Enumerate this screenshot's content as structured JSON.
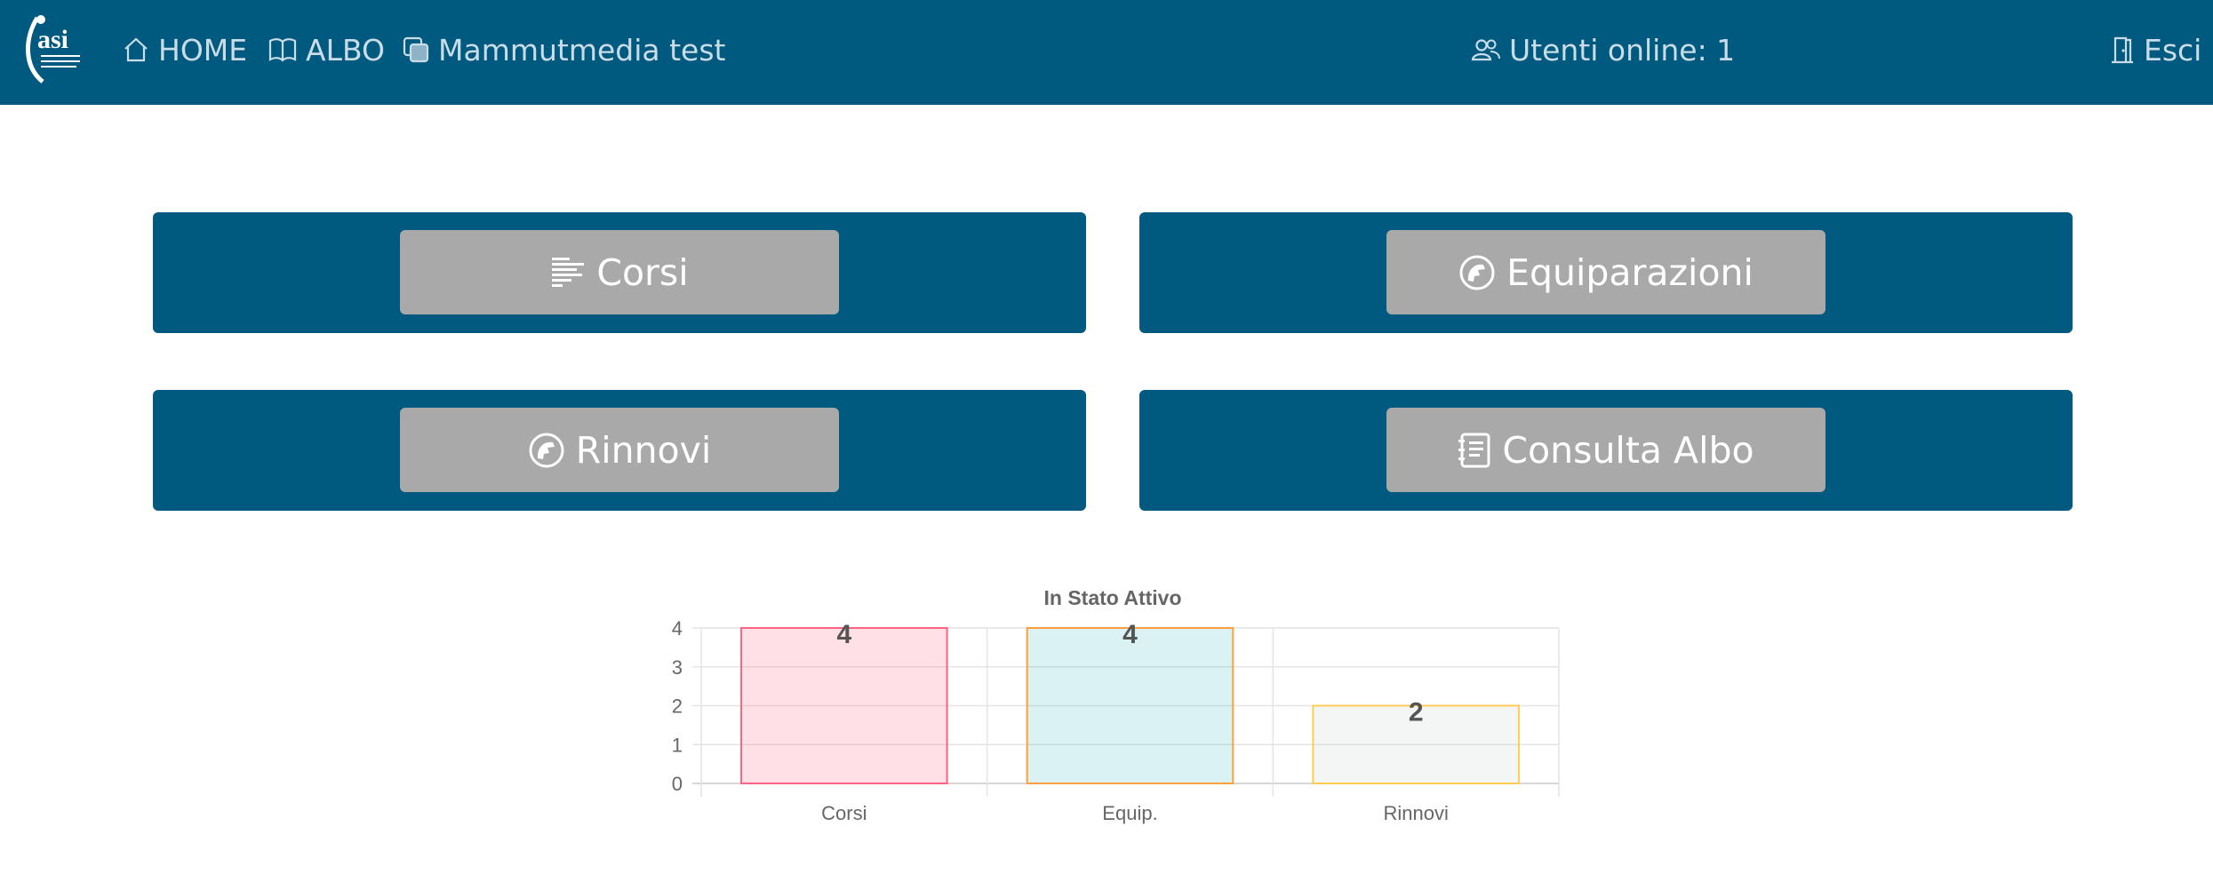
{
  "nav": {
    "logo_text": "asi",
    "home_label": "HOME",
    "albo_label": "ALBO",
    "mammut_label": "Mammutmedia test",
    "users_online": "Utenti online: 1",
    "logout_label": "Esci",
    "icons": [
      "home-icon",
      "book-icon",
      "layers-icon",
      "users-icon",
      "door-icon"
    ]
  },
  "cards": {
    "corsi": "Corsi",
    "equiparazioni": "Equiparazioni",
    "rinnovi": "Rinnovi",
    "consulta_albo": "Consulta Albo"
  },
  "colors": {
    "navbar": "#005a7f",
    "button": "#a9a9a9"
  },
  "chart_data": {
    "type": "bar",
    "title": "In Stato Attivo",
    "categories": [
      "Corsi",
      "Equip.",
      "Rinnovi"
    ],
    "values": [
      4,
      4,
      2
    ],
    "ylim": [
      0,
      4
    ],
    "yticks": [
      0,
      1,
      2,
      3,
      4
    ],
    "grid": true,
    "bar_fill": [
      "rgba(255,99,132,0.2)",
      "rgba(75,192,192,0.2)",
      "rgba(201,203,207,0.2)"
    ],
    "bar_border": [
      "#ff6384",
      "#ff9f40",
      "#ffcd56"
    ]
  }
}
